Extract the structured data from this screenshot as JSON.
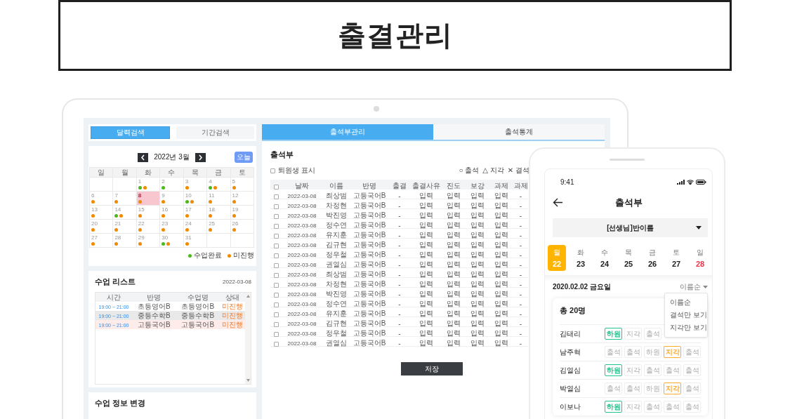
{
  "header": {
    "title": "출결관리"
  },
  "left_tabs": [
    {
      "label": "달력검색",
      "selected": true
    },
    {
      "label": "기간검색",
      "selected": false
    }
  ],
  "calendar": {
    "month": "2022년 3월",
    "today_button": "오늘",
    "weekdays": [
      "일",
      "월",
      "화",
      "수",
      "목",
      "금",
      "토"
    ],
    "weeks": [
      [
        {
          "kind": "blank"
        },
        {
          "kind": "blank"
        },
        {
          "day": "1",
          "dots": [
            {
              "kind": "done"
            },
            {
              "kind": "pending"
            }
          ],
          "selected": false
        },
        {
          "day": "2",
          "dots": [
            {
              "kind": "done"
            }
          ],
          "selected": false
        },
        {
          "day": "3",
          "dots": [
            {
              "kind": "pending"
            }
          ],
          "selected": false
        },
        {
          "day": "4",
          "dots": [
            {
              "kind": "done"
            },
            {
              "kind": "pending"
            }
          ],
          "selected": false
        },
        {
          "day": "5",
          "dots": [
            {
              "kind": "pending"
            }
          ],
          "selected": false
        }
      ],
      [
        {
          "day": "6",
          "dots": [
            {
              "kind": "pending"
            }
          ],
          "selected": false
        },
        {
          "day": "7",
          "dots": [
            {
              "kind": "pending"
            }
          ],
          "selected": false
        },
        {
          "day": "8",
          "dots": [
            {
              "kind": "pending"
            }
          ],
          "selected": true
        },
        {
          "day": "9",
          "dots": [
            {
              "kind": "pending"
            }
          ],
          "selected": false
        },
        {
          "day": "10",
          "dots": [
            {
              "kind": "done"
            },
            {
              "kind": "pending"
            }
          ],
          "selected": false
        },
        {
          "day": "11",
          "dots": [
            {
              "kind": "pending"
            }
          ],
          "selected": false
        },
        {
          "day": "12",
          "dots": [
            {
              "kind": "pending"
            }
          ],
          "selected": false
        }
      ],
      [
        {
          "day": "13",
          "dots": [
            {
              "kind": "pending"
            }
          ],
          "selected": false
        },
        {
          "day": "14",
          "dots": [
            {
              "kind": "done"
            },
            {
              "kind": "pending"
            }
          ],
          "selected": false
        },
        {
          "day": "15",
          "dots": [
            {
              "kind": "pending"
            }
          ],
          "selected": false
        },
        {
          "day": "16",
          "dots": [
            {
              "kind": "pending"
            }
          ],
          "selected": false
        },
        {
          "day": "17",
          "dots": [
            {
              "kind": "pending"
            }
          ],
          "selected": false
        },
        {
          "day": "18",
          "dots": [
            {
              "kind": "pending"
            }
          ],
          "selected": false
        },
        {
          "day": "19",
          "dots": [
            {
              "kind": "pending"
            }
          ],
          "selected": false
        }
      ],
      [
        {
          "day": "20",
          "dots": [
            {
              "kind": "pending"
            }
          ],
          "selected": false
        },
        {
          "day": "21",
          "dots": [
            {
              "kind": "pending"
            }
          ],
          "selected": false
        },
        {
          "day": "22",
          "dots": [
            {
              "kind": "pending"
            }
          ],
          "selected": false
        },
        {
          "day": "23",
          "dots": [
            {
              "kind": "pending"
            }
          ],
          "selected": false
        },
        {
          "day": "24",
          "dots": [
            {
              "kind": "pending"
            }
          ],
          "selected": false
        },
        {
          "day": "25",
          "dots": [
            {
              "kind": "pending"
            }
          ],
          "selected": false
        },
        {
          "day": "26",
          "dots": [
            {
              "kind": "pending"
            }
          ],
          "selected": false
        }
      ],
      [
        {
          "day": "27",
          "dots": [
            {
              "kind": "pending"
            }
          ],
          "selected": false
        },
        {
          "day": "28",
          "dots": [
            {
              "kind": "pending"
            }
          ],
          "selected": false
        },
        {
          "day": "29",
          "dots": [
            {
              "kind": "pending"
            }
          ],
          "selected": false
        },
        {
          "day": "30",
          "dots": [
            {
              "kind": "done"
            },
            {
              "kind": "pending"
            }
          ],
          "selected": false
        },
        {
          "day": "31",
          "dots": [
            {
              "kind": "pending"
            }
          ],
          "selected": false
        },
        {
          "kind": "blank"
        },
        {
          "kind": "blank"
        }
      ]
    ],
    "legend": [
      {
        "kind": "done",
        "label": "수업완료"
      },
      {
        "kind": "pending",
        "label": "미진행"
      }
    ]
  },
  "lesson_list": {
    "title": "수업 리스트",
    "date": "2022-03-08",
    "columns": [
      "시간",
      "반명",
      "수업명",
      "상태"
    ],
    "rows": [
      {
        "time": "19:00 ~ 21:00",
        "class": "초등영어B",
        "lesson": "초등영어B",
        "status": "미진행",
        "selected": false,
        "hovered": false
      },
      {
        "time": "19:00 ~ 21:00",
        "class": "중등수학B",
        "lesson": "중등수학B",
        "status": "미진행",
        "selected": false,
        "hovered": true
      },
      {
        "time": "19:00 ~ 21:00",
        "class": "고등국어B",
        "lesson": "고등국어B",
        "status": "미진행",
        "selected": true,
        "hovered": false
      }
    ]
  },
  "lesson_edit": {
    "title": "수업 정보 변경"
  },
  "right_tabs": [
    {
      "label": "출석부관리",
      "selected": true
    },
    {
      "label": "출석통계",
      "selected": false
    }
  ],
  "attendance": {
    "title": "출석부",
    "show_withdrawn": {
      "label": "퇴원생 표시",
      "checked": false
    },
    "legend": [
      {
        "symbol": "○",
        "label": "출석"
      },
      {
        "symbol": "△",
        "label": "지각"
      },
      {
        "symbol": "✕",
        "label": "결석"
      }
    ],
    "select_all_checked": false,
    "columns": [
      "날짜",
      "이름",
      "반명",
      "출결",
      "출결사유",
      "진도",
      "보강",
      "과제",
      "과제"
    ],
    "rows": [
      {
        "checked": false,
        "date": "2022-03-08",
        "name": "최상범",
        "class": "고등국어B",
        "attendance": "-",
        "reason": "입력",
        "progress": "입력",
        "makeup": "입력",
        "homework": "입력",
        "column_10": "-"
      },
      {
        "checked": false,
        "date": "2022-03-08",
        "name": "차정현",
        "class": "고등국어B",
        "attendance": "-",
        "reason": "입력",
        "progress": "입력",
        "makeup": "입력",
        "homework": "입력",
        "column_10": "-"
      },
      {
        "checked": false,
        "date": "2022-03-08",
        "name": "박진영",
        "class": "고등국어B",
        "attendance": "-",
        "reason": "입력",
        "progress": "입력",
        "makeup": "입력",
        "homework": "입력",
        "column_10": "-"
      },
      {
        "checked": false,
        "date": "2022-03-08",
        "name": "정수연",
        "class": "고등국어B",
        "attendance": "-",
        "reason": "입력",
        "progress": "입력",
        "makeup": "입력",
        "homework": "입력",
        "column_10": "-"
      },
      {
        "checked": false,
        "date": "2022-03-08",
        "name": "유지훈",
        "class": "고등국어B",
        "attendance": "-",
        "reason": "입력",
        "progress": "입력",
        "makeup": "입력",
        "homework": "입력",
        "column_10": "-"
      },
      {
        "checked": false,
        "date": "2022-03-08",
        "name": "김규현",
        "class": "고등국어B",
        "attendance": "-",
        "reason": "입력",
        "progress": "입력",
        "makeup": "입력",
        "homework": "입력",
        "column_10": "-"
      },
      {
        "checked": false,
        "date": "2022-03-08",
        "name": "정우철",
        "class": "고등국어B",
        "attendance": "-",
        "reason": "입력",
        "progress": "입력",
        "makeup": "입력",
        "homework": "입력",
        "column_10": "-"
      },
      {
        "checked": false,
        "date": "2022-03-08",
        "name": "권열심",
        "class": "고등국어B",
        "attendance": "-",
        "reason": "입력",
        "progress": "입력",
        "makeup": "입력",
        "homework": "입력",
        "column_10": "-"
      },
      {
        "checked": false,
        "date": "2022-03-08",
        "name": "최상범",
        "class": "고등국어B",
        "attendance": "-",
        "reason": "입력",
        "progress": "입력",
        "makeup": "입력",
        "homework": "입력",
        "column_10": "-"
      },
      {
        "checked": false,
        "date": "2022-03-08",
        "name": "차정현",
        "class": "고등국어B",
        "attendance": "-",
        "reason": "입력",
        "progress": "입력",
        "makeup": "입력",
        "homework": "입력",
        "column_10": "-"
      },
      {
        "checked": false,
        "date": "2022-03-08",
        "name": "박진영",
        "class": "고등국어B",
        "attendance": "-",
        "reason": "입력",
        "progress": "입력",
        "makeup": "입력",
        "homework": "입력",
        "column_10": "-"
      },
      {
        "checked": false,
        "date": "2022-03-08",
        "name": "정수연",
        "class": "고등국어B",
        "attendance": "-",
        "reason": "입력",
        "progress": "입력",
        "makeup": "입력",
        "homework": "입력",
        "column_10": "-"
      },
      {
        "checked": false,
        "date": "2022-03-08",
        "name": "유지훈",
        "class": "고등국어B",
        "attendance": "-",
        "reason": "입력",
        "progress": "입력",
        "makeup": "입력",
        "homework": "입력",
        "column_10": "-"
      },
      {
        "checked": false,
        "date": "2022-03-08",
        "name": "김규현",
        "class": "고등국어B",
        "attendance": "-",
        "reason": "입력",
        "progress": "입력",
        "makeup": "입력",
        "homework": "입력",
        "column_10": "-"
      },
      {
        "checked": false,
        "date": "2022-03-08",
        "name": "정우철",
        "class": "고등국어B",
        "attendance": "-",
        "reason": "입력",
        "progress": "입력",
        "makeup": "입력",
        "homework": "입력",
        "column_10": "-"
      },
      {
        "checked": false,
        "date": "2022-03-08",
        "name": "권열심",
        "class": "고등국어B",
        "attendance": "-",
        "reason": "입력",
        "progress": "입력",
        "makeup": "입력",
        "homework": "입력",
        "column_10": "-"
      }
    ],
    "save_button": "저장"
  },
  "mobile": {
    "time": "9:41",
    "title": "출석부",
    "class_select": "[선생님]반이름",
    "week": [
      {
        "weekday": "월",
        "date": "22",
        "selected": true,
        "holiday": false
      },
      {
        "weekday": "화",
        "date": "23",
        "selected": false,
        "holiday": false
      },
      {
        "weekday": "수",
        "date": "24",
        "selected": false,
        "holiday": false
      },
      {
        "weekday": "목",
        "date": "25",
        "selected": false,
        "holiday": false
      },
      {
        "weekday": "금",
        "date": "26",
        "selected": false,
        "holiday": false
      },
      {
        "weekday": "토",
        "date": "27",
        "selected": false,
        "holiday": false
      },
      {
        "weekday": "일",
        "date": "28",
        "selected": false,
        "holiday": true
      }
    ],
    "date_label": "2020.02.02 금요일",
    "sort": "이름순",
    "sort_menu": [
      "이름순",
      "결석만 보기",
      "지각만 보기"
    ],
    "total": "총 20명",
    "students": [
      {
        "name": "김태리",
        "chips": [
          {
            "label": "하원",
            "selected": true,
            "color": "#22c58b"
          },
          {
            "label": "지각",
            "selected": false
          },
          {
            "label": "출석",
            "selected": false
          }
        ]
      },
      {
        "name": "남주혁",
        "chips": [
          {
            "label": "출석",
            "selected": false
          },
          {
            "label": "출석",
            "selected": false
          },
          {
            "label": "하원",
            "selected": false
          },
          {
            "label": "지각",
            "selected": true,
            "color": "#ffaa2b"
          },
          {
            "label": "출석",
            "selected": false
          }
        ]
      },
      {
        "name": "김열심",
        "chips": [
          {
            "label": "하원",
            "selected": true,
            "color": "#22c58b"
          },
          {
            "label": "지각",
            "selected": false
          },
          {
            "label": "출석",
            "selected": false
          },
          {
            "label": "출석",
            "selected": false
          },
          {
            "label": "출석",
            "selected": false
          }
        ]
      },
      {
        "name": "박열심",
        "chips": [
          {
            "label": "출석",
            "selected": false
          },
          {
            "label": "출석",
            "selected": false
          },
          {
            "label": "하원",
            "selected": false
          },
          {
            "label": "지각",
            "selected": true,
            "color": "#ffaa2b"
          },
          {
            "label": "출석",
            "selected": false
          }
        ]
      },
      {
        "name": "이보나",
        "chips": [
          {
            "label": "하원",
            "selected": true,
            "color": "#22c58b"
          },
          {
            "label": "지각",
            "selected": false
          },
          {
            "label": "출석",
            "selected": false
          },
          {
            "label": "출석",
            "selected": false
          },
          {
            "label": "출석",
            "selected": false
          }
        ]
      }
    ]
  }
}
